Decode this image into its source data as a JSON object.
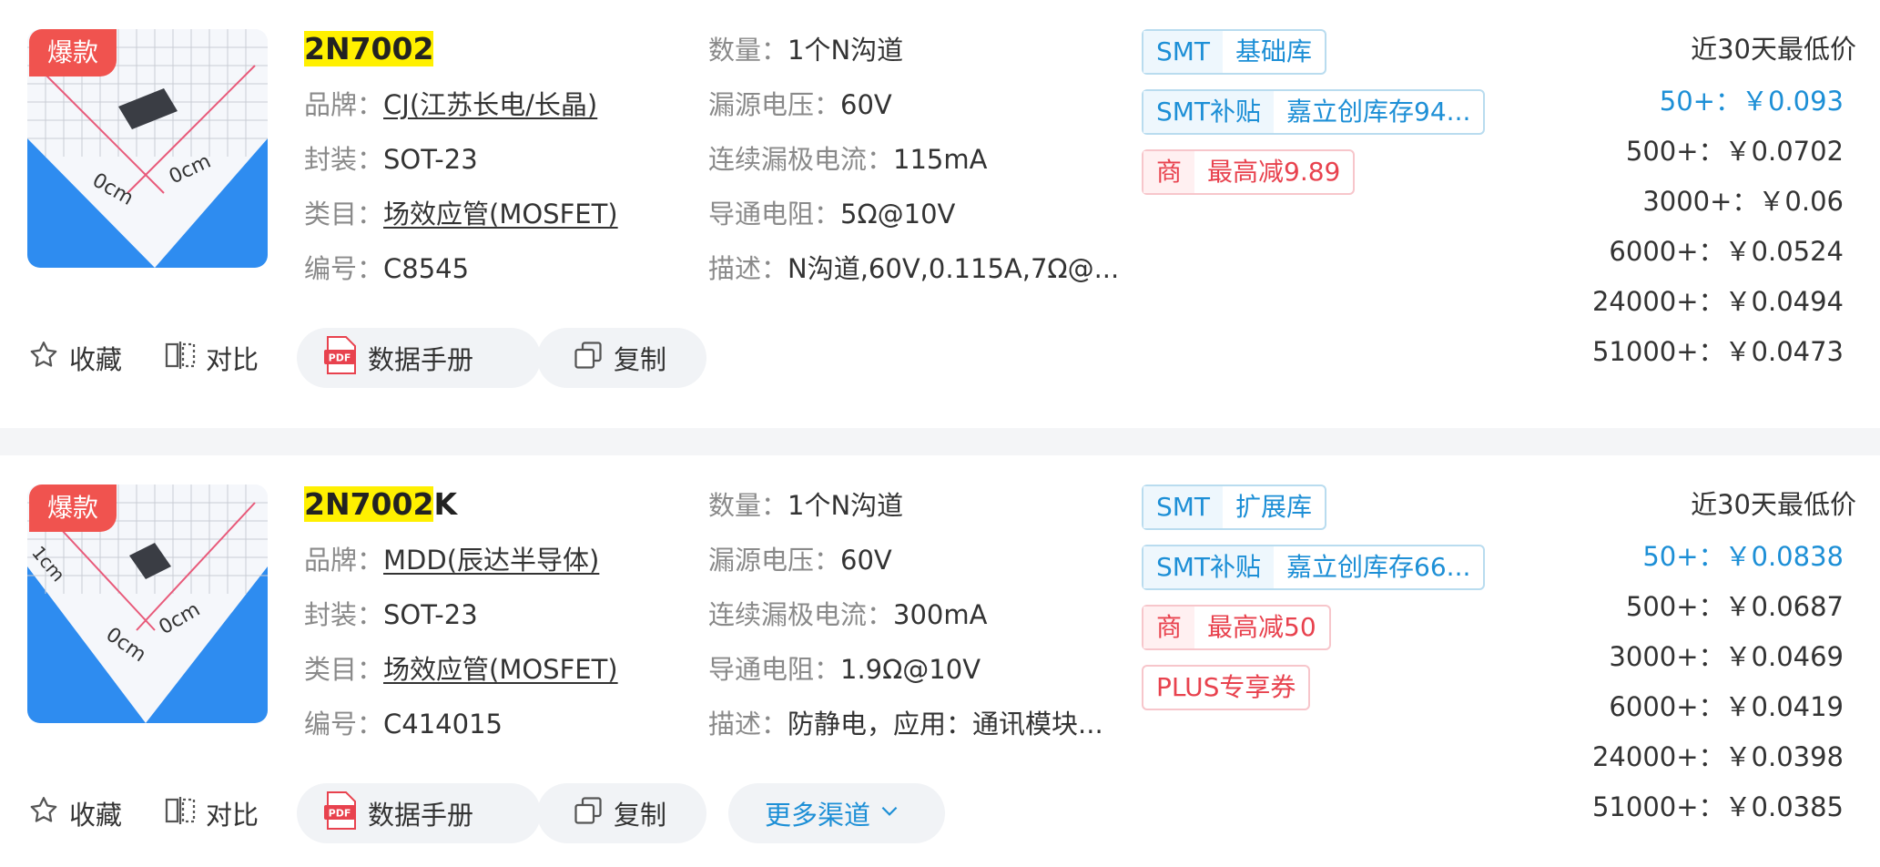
{
  "products": [
    {
      "hot_badge": "爆款",
      "part_prefix": "2N7002",
      "part_suffix": "",
      "brand_label": "品牌：",
      "brand": "CJ(江苏长电/长晶)",
      "package_label": "封装：",
      "package": "SOT-23",
      "category_label": "类目：",
      "category": "场效应管(MOSFET)",
      "code_label": "编号：",
      "code": "C8545",
      "qty_label": "数量：",
      "qty": "1个N沟道",
      "vds_label": "漏源电压：",
      "vds": "60V",
      "id_label": "连续漏极电流：",
      "id": "115mA",
      "rds_label": "导通电阻：",
      "rds": "5Ω@10V",
      "desc_label": "描述：",
      "desc": "N沟道,60V,0.115A,7Ω@...",
      "tags": [
        {
          "a": "SMT",
          "b": "基础库",
          "style": "blue"
        },
        {
          "a": "SMT补贴",
          "b": "嘉立创库存94...",
          "style": "blue"
        },
        {
          "a": "商",
          "b": "最高减9.89",
          "style": "red"
        }
      ],
      "price_title": "近30天最低价",
      "prices": [
        "50+：￥0.093",
        "500+：￥0.0702",
        "3000+：￥0.06",
        "6000+：￥0.0524",
        "24000+：￥0.0494",
        "51000+：￥0.0473"
      ],
      "actions": {
        "favorite": "收藏",
        "compare": "对比",
        "datasheet": "数据手册",
        "copy": "复制",
        "more": ""
      }
    },
    {
      "hot_badge": "爆款",
      "part_prefix": "2N7002",
      "part_suffix": "K",
      "brand_label": "品牌：",
      "brand": "MDD(辰达半导体)",
      "package_label": "封装：",
      "package": "SOT-23",
      "category_label": "类目：",
      "category": "场效应管(MOSFET)",
      "code_label": "编号：",
      "code": "C414015",
      "qty_label": "数量：",
      "qty": "1个N沟道",
      "vds_label": "漏源电压：",
      "vds": "60V",
      "id_label": "连续漏极电流：",
      "id": "300mA",
      "rds_label": "导通电阻：",
      "rds": "1.9Ω@10V",
      "desc_label": "描述：",
      "desc": "防静电，应用：通讯模块...",
      "tags": [
        {
          "a": "SMT",
          "b": "扩展库",
          "style": "blue"
        },
        {
          "a": "SMT补贴",
          "b": "嘉立创库存66...",
          "style": "blue"
        },
        {
          "a": "商",
          "b": "最高减50",
          "style": "red"
        },
        {
          "a": "",
          "b": "PLUS专享券",
          "style": "plus"
        }
      ],
      "price_title": "近30天最低价",
      "prices": [
        "50+：￥0.0838",
        "500+：￥0.0687",
        "3000+：￥0.0469",
        "6000+：￥0.0419",
        "24000+：￥0.0398",
        "51000+：￥0.0385"
      ],
      "actions": {
        "favorite": "收藏",
        "compare": "对比",
        "datasheet": "数据手册",
        "copy": "复制",
        "more": "更多渠道"
      }
    }
  ],
  "icons": {
    "favorite": "star-icon",
    "compare": "compare-icon",
    "datasheet": "pdf-icon",
    "copy": "copy-icon",
    "more": "chevron-down-icon"
  },
  "colors": {
    "accent_blue": "#1d8fd6",
    "hot_red": "#f0534f",
    "highlight_yellow": "#fff000",
    "promo_red": "#e8424e"
  }
}
